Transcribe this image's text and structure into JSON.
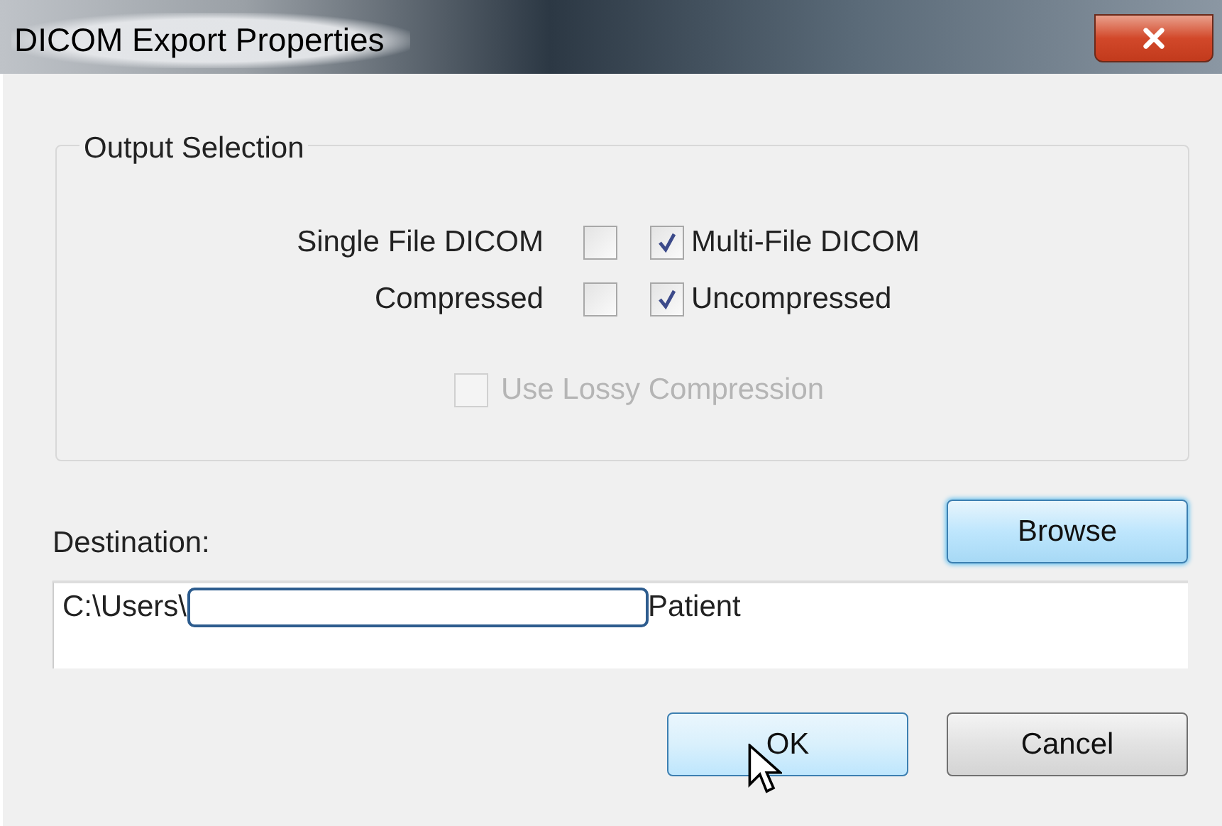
{
  "window": {
    "title": "DICOM Export Properties"
  },
  "output_selection": {
    "title": "Output Selection",
    "rows": [
      {
        "label": "Single File DICOM",
        "left_checked": false,
        "right_checked": true,
        "right_label": "Multi-File DICOM"
      },
      {
        "label": "Compressed",
        "left_checked": false,
        "right_checked": true,
        "right_label": "Uncompressed"
      }
    ],
    "lossy": {
      "label": "Use Lossy Compression",
      "checked": false,
      "disabled": true
    }
  },
  "destination": {
    "label": "Destination:",
    "browse": {
      "label": "Browse",
      "highlighted": true
    },
    "value_start": "C:\\Users\\",
    "redacted": true,
    "value_end": "Patient"
  },
  "buttons": [
    {
      "label": "OK",
      "hovered": true,
      "cursor": true
    },
    {
      "label": "Cancel",
      "hovered": false,
      "cursor": false
    }
  ]
}
